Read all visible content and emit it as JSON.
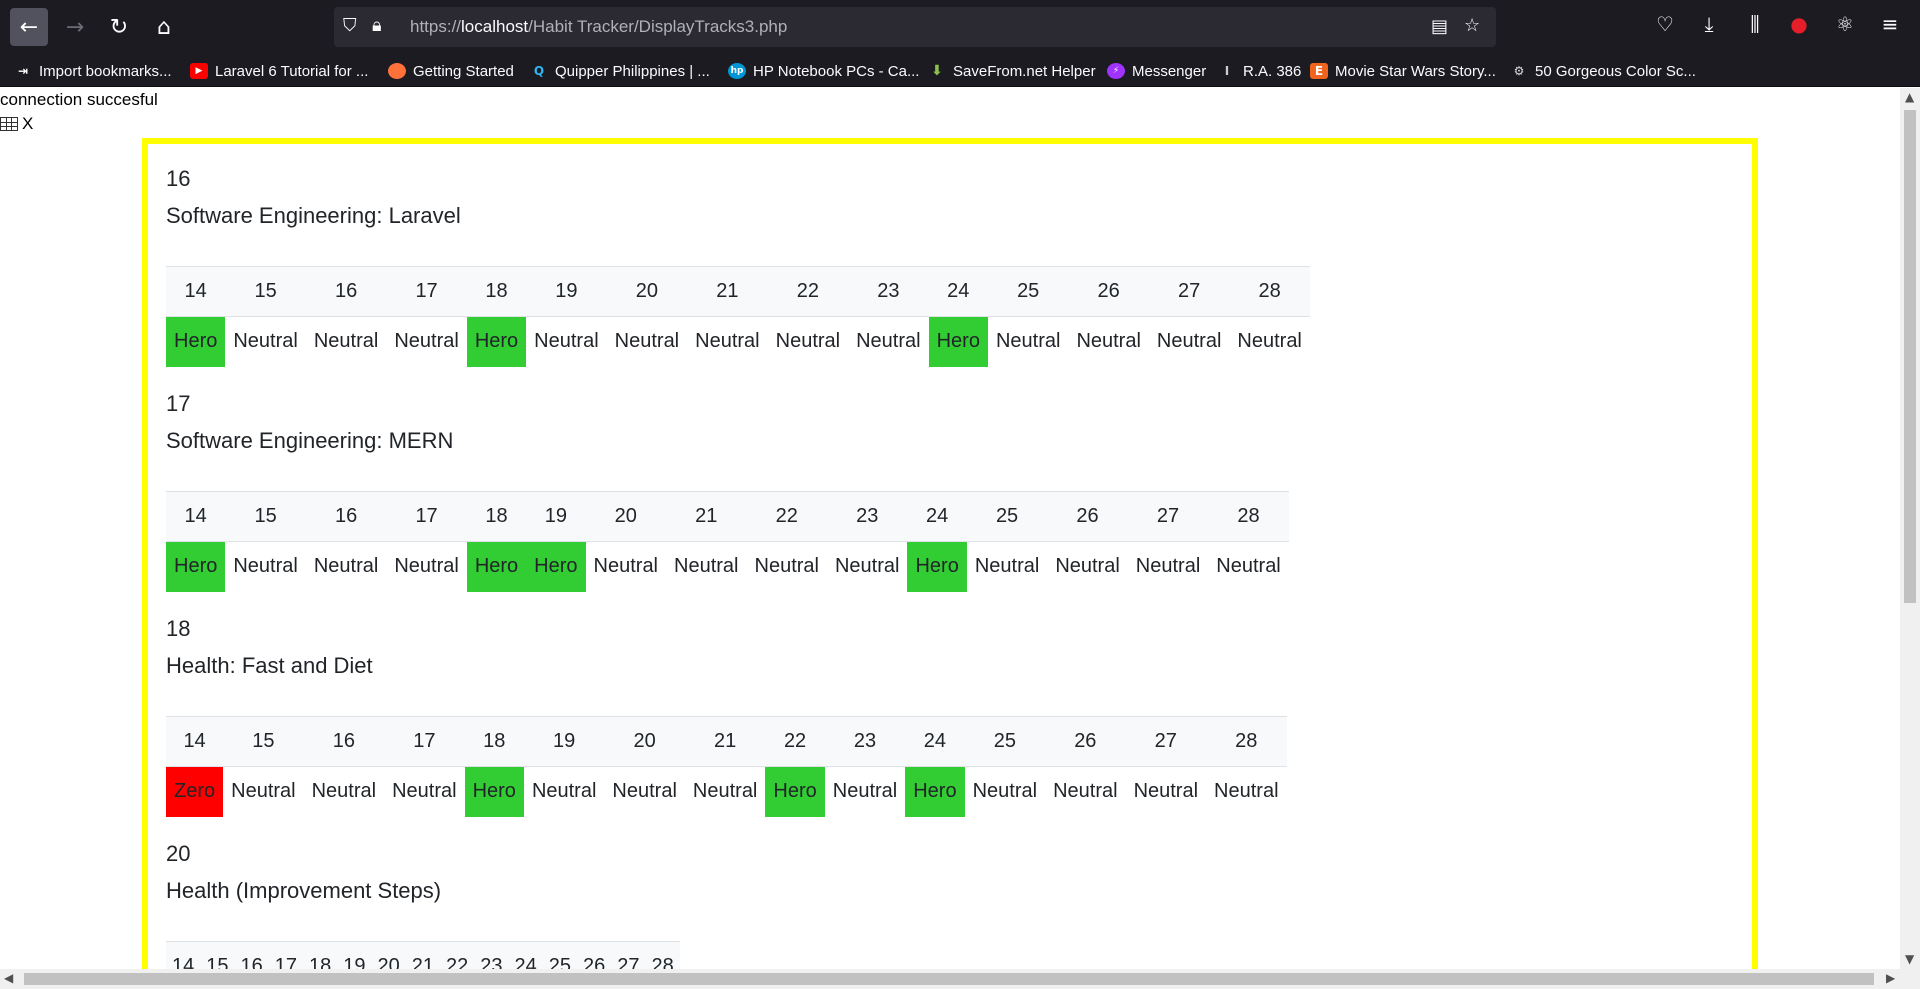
{
  "browser": {
    "url_prefix": "https://",
    "url_host": "localhost",
    "url_path": "/Habit Tracker/DisplayTracks3.php",
    "bookmarks": [
      {
        "label": "Import bookmarks...",
        "icon": "import-icon"
      },
      {
        "label": "Laravel 6 Tutorial for ...",
        "icon": "youtube-icon"
      },
      {
        "label": "Getting Started",
        "icon": "firefox-icon"
      },
      {
        "label": "Quipper Philippines | ...",
        "icon": "quipper-icon"
      },
      {
        "label": "HP Notebook PCs - Ca...",
        "icon": "hp-icon"
      },
      {
        "label": "SaveFrom.net Helper",
        "icon": "download-arrow-icon"
      },
      {
        "label": "Messenger",
        "icon": "messenger-icon"
      },
      {
        "label": "R.A. 386",
        "icon": "text-cursor-icon"
      },
      {
        "label": "Movie Star Wars Story...",
        "icon": "etsy-icon"
      },
      {
        "label": "50 Gorgeous Color Sc...",
        "icon": "gear-icon"
      }
    ]
  },
  "page": {
    "connection_message": "connection succesful",
    "table_link_label": "X"
  },
  "day_headers": [
    "14",
    "15",
    "16",
    "17",
    "18",
    "19",
    "20",
    "21",
    "22",
    "23",
    "24",
    "25",
    "26",
    "27",
    "28"
  ],
  "habits": [
    {
      "id": "16",
      "name": "Software Engineering: Laravel",
      "statuses": [
        "Hero",
        "Neutral",
        "Neutral",
        "Neutral",
        "Hero",
        "Neutral",
        "Neutral",
        "Neutral",
        "Neutral",
        "Neutral",
        "Hero",
        "Neutral",
        "Neutral",
        "Neutral",
        "Neutral"
      ]
    },
    {
      "id": "17",
      "name": "Software Engineering: MERN",
      "statuses": [
        "Hero",
        "Neutral",
        "Neutral",
        "Neutral",
        "Hero",
        "Hero",
        "Neutral",
        "Neutral",
        "Neutral",
        "Neutral",
        "Hero",
        "Neutral",
        "Neutral",
        "Neutral",
        "Neutral"
      ]
    },
    {
      "id": "18",
      "name": "Health: Fast and Diet",
      "statuses": [
        "Zero",
        "Neutral",
        "Neutral",
        "Neutral",
        "Hero",
        "Neutral",
        "Neutral",
        "Neutral",
        "Hero",
        "Neutral",
        "Hero",
        "Neutral",
        "Neutral",
        "Neutral",
        "Neutral"
      ]
    },
    {
      "id": "20",
      "name": "Health (Improvement Steps)",
      "statuses": []
    }
  ],
  "colors": {
    "Hero": "#32cd32",
    "Zero": "#ff0000",
    "frame": "#ffff00"
  }
}
